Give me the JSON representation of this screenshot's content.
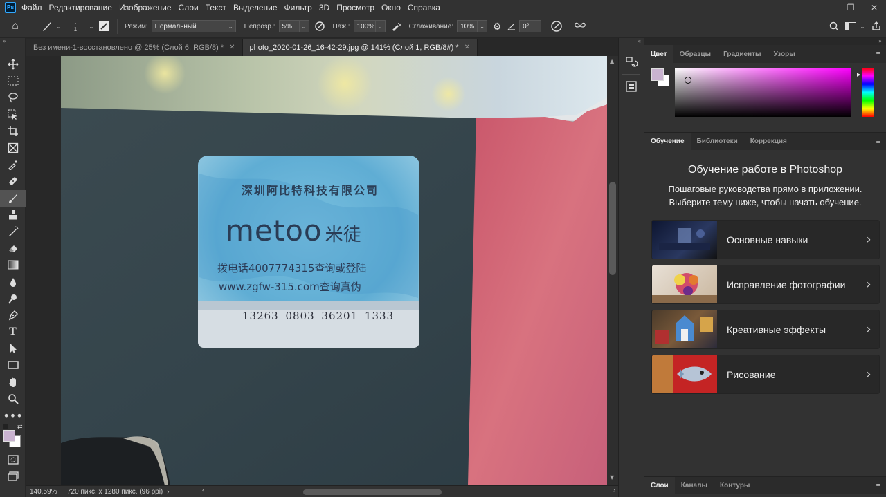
{
  "app": {
    "logo": "Ps"
  },
  "menu": [
    "Файл",
    "Редактирование",
    "Изображение",
    "Слои",
    "Текст",
    "Выделение",
    "Фильтр",
    "3D",
    "Просмотр",
    "Окно",
    "Справка"
  ],
  "window_controls": {
    "minimize": "—",
    "restore": "❐",
    "close": "✕"
  },
  "options": {
    "brush_size": "1",
    "mode_label": "Режим:",
    "mode_value": "Нормальный",
    "opacity_label": "Непрозр.:",
    "opacity_value": "5%",
    "flow_label": "Наж.:",
    "flow_value": "100%",
    "smoothing_label": "Сглаживание:",
    "smoothing_value": "10%",
    "angle_value": "0°"
  },
  "tabs": [
    {
      "title": "Без имени-1-восстановлено @ 25% (Слой 6, RGB/8) *",
      "active": false
    },
    {
      "title": "photo_2020-01-26_16-42-29.jpg @ 141% (Слой 1, RGB/8#) *",
      "active": true
    }
  ],
  "status": {
    "zoom": "140,59%",
    "doc_info": "720 пикс. x 1280 пикс. (96 ppi)"
  },
  "photo_label": {
    "company": "深圳阿比特科技有限公司",
    "brand": "metoo",
    "brand_cn": "米徒",
    "phone_line": "拨电话4007774315查询或登陆",
    "web_line": "www.zgfw-315.com查询真伪",
    "code": "13263 0803 36201 1333"
  },
  "color_panel": {
    "tabs": [
      "Цвет",
      "Образцы",
      "Градиенты",
      "Узоры"
    ],
    "active_tab": "Цвет",
    "fg_color": "#c9b3d0",
    "bg_color": "#ffffff",
    "hue_color": "#ff00ff"
  },
  "learn_panel": {
    "tabs": [
      "Обучение",
      "Библиотеки",
      "Коррекция"
    ],
    "active_tab": "Обучение",
    "title": "Обучение работе в Photoshop",
    "subtitle": "Пошаговые руководства прямо в приложении. Выберите тему ниже, чтобы начать обучение.",
    "items": [
      "Основные навыки",
      "Исправление фотографии",
      "Креативные эффекты",
      "Рисование"
    ]
  },
  "layers_panel": {
    "tabs": [
      "Слои",
      "Каналы",
      "Контуры"
    ],
    "active_tab": "Слои"
  }
}
